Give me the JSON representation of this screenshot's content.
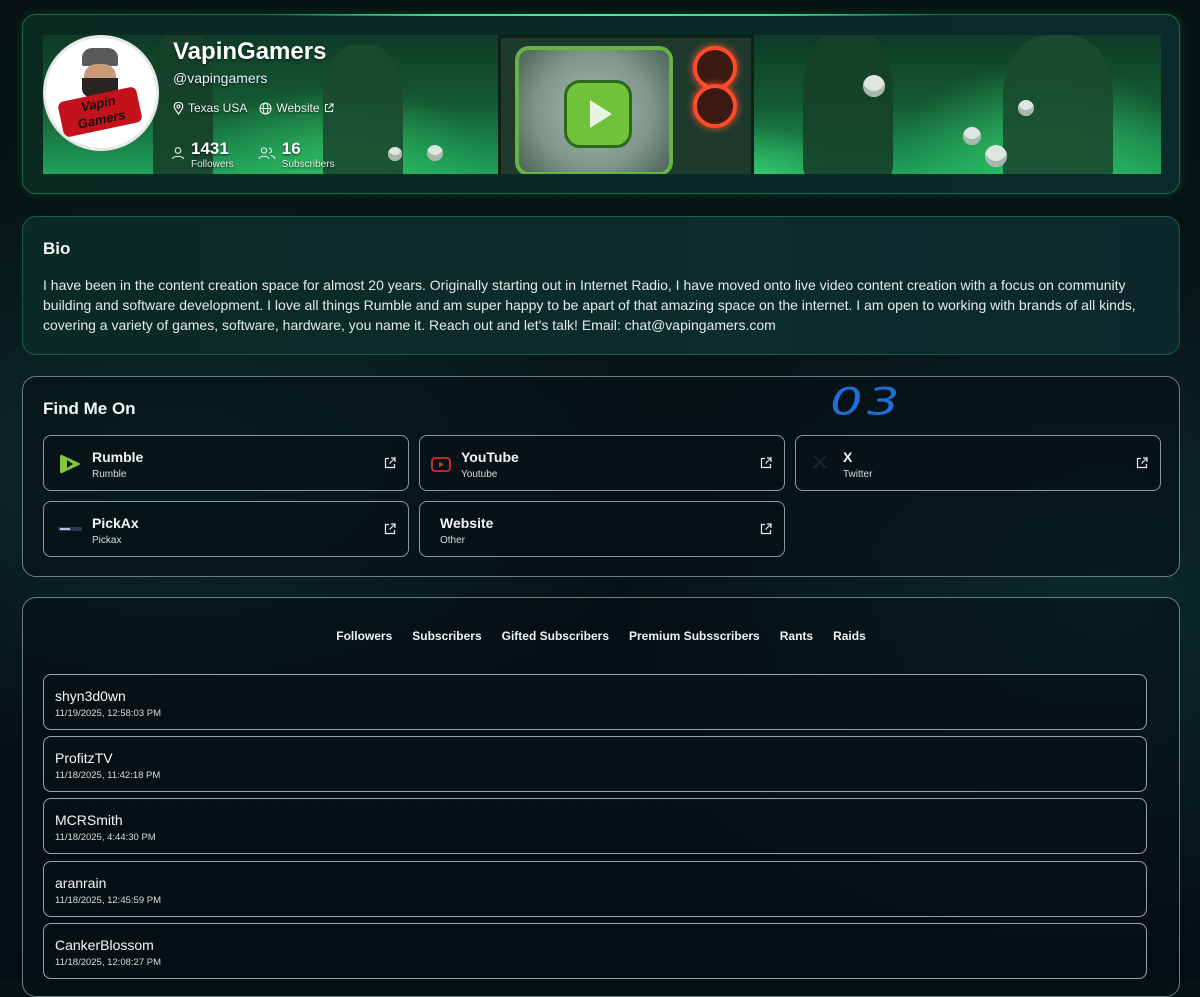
{
  "profile": {
    "name": "VapinGamers",
    "handle": "@vapingamers",
    "location": "Texas USA",
    "website_label": "Website",
    "followers_count": "1431",
    "followers_label": "Followers",
    "subscribers_count": "16",
    "subscribers_label": "Subscribers",
    "avatar_text": "Vapin Gamers"
  },
  "bio": {
    "title": "Bio",
    "text": "I have been in the content creation space for almost 20 years. Originally starting out in Internet Radio, I have moved onto live video content creation with a focus on community building and software development. I love all things Rumble and am super happy to be apart of that amazing space on the internet. I am open to working with brands of all kinds, covering a variety of games, software, hardware, you name it. Reach out and let's talk! Email: chat@vapingamers.com"
  },
  "find_me_on": {
    "title": "Find Me On",
    "links": [
      {
        "title": "Rumble",
        "subtitle": "Rumble",
        "icon": "rumble-icon"
      },
      {
        "title": "YouTube",
        "subtitle": "Youtube",
        "icon": "youtube-icon"
      },
      {
        "title": "X",
        "subtitle": "Twitter",
        "icon": "x-icon"
      },
      {
        "title": "PickAx",
        "subtitle": "Pickax",
        "icon": "pickax-icon"
      },
      {
        "title": "Website",
        "subtitle": "Other",
        "icon": ""
      }
    ]
  },
  "annotation": "03",
  "activity": {
    "tabs": [
      "Followers",
      "Subscribers",
      "Gifted Subscribers",
      "Premium Subsscribers",
      "Rants",
      "Raids"
    ],
    "rows": [
      {
        "name": "shyn3d0wn",
        "time": "11/19/2025, 12:58:03 PM"
      },
      {
        "name": "ProfitzTV",
        "time": "11/18/2025, 11:42:18 PM"
      },
      {
        "name": "MCRSmith",
        "time": "11/18/2025, 4:44:30 PM"
      },
      {
        "name": "aranrain",
        "time": "11/18/2025, 12:45:59 PM"
      },
      {
        "name": "CankerBlossom",
        "time": "11/18/2025, 12:08:27 PM"
      }
    ]
  },
  "colors": {
    "accent": "#2ee08a",
    "rumble_green": "#85c742",
    "youtube_red": "#e02a2a"
  }
}
